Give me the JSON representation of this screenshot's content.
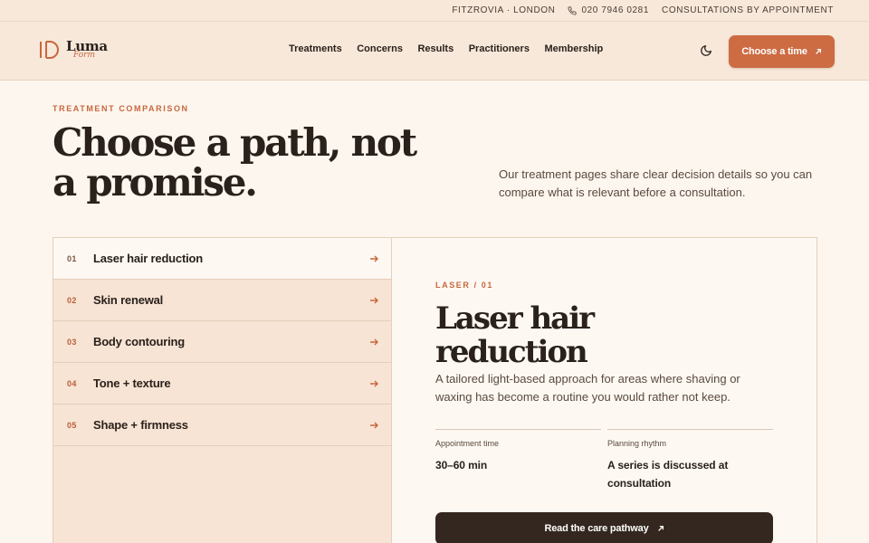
{
  "utility_bar": {
    "location": "FITZROVIA · LONDON",
    "phone": "020 7946 0281",
    "note": "CONSULTATIONS BY APPOINTMENT"
  },
  "brand": {
    "name_line1": "Luma",
    "name_line2": "Form"
  },
  "nav": {
    "items": [
      {
        "label": "Treatments"
      },
      {
        "label": "Concerns"
      },
      {
        "label": "Results"
      },
      {
        "label": "Practitioners"
      },
      {
        "label": "Membership"
      }
    ],
    "cta_label": "Choose a time"
  },
  "hero": {
    "eyebrow": "TREATMENT COMPARISON",
    "title": "Choose a path, not a promise.",
    "subtitle": "Our treatment pages share clear decision details so you can compare what is relevant before a consultation."
  },
  "treatments": [
    {
      "num": "01",
      "label": "Laser hair reduction",
      "active": true
    },
    {
      "num": "02",
      "label": "Skin renewal"
    },
    {
      "num": "03",
      "label": "Body contouring"
    },
    {
      "num": "04",
      "label": "Tone + texture"
    },
    {
      "num": "05",
      "label": "Shape + firmness"
    }
  ],
  "detail": {
    "eyebrow": "LASER / 01",
    "title": "Laser hair reduction",
    "description": "A tailored light-based approach for areas where shaving or waxing has become a routine you would rather not keep.",
    "meta": [
      {
        "key": "Appointment time",
        "value": "30–60 min"
      },
      {
        "key": "Planning rhythm",
        "value": "A series is discussed at consultation"
      }
    ],
    "cta_label": "Read the care pathway"
  },
  "colors": {
    "accent": "#cd6b42",
    "dark_button": "#33271f",
    "background": "#fdf6ee",
    "header_bg": "#f7e8da"
  }
}
